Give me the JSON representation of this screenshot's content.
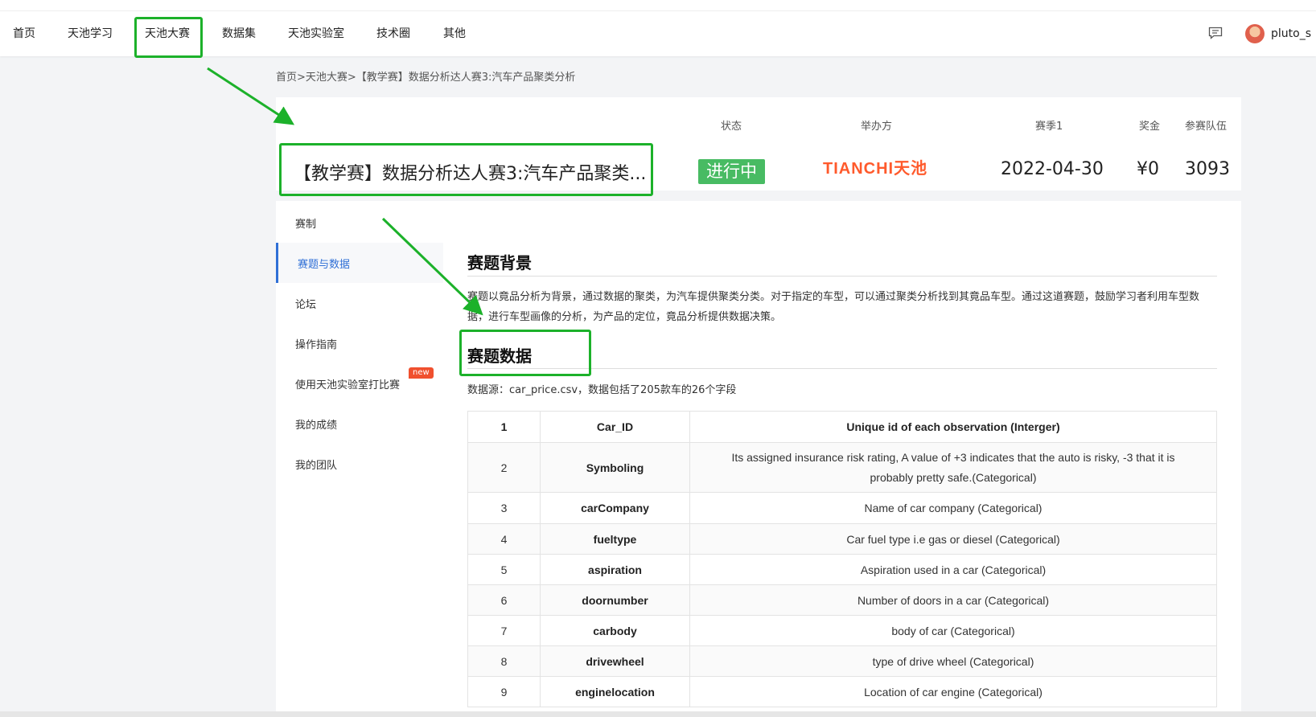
{
  "nav": {
    "items": [
      "首页",
      "天池学习",
      "天池大赛",
      "数据集",
      "天池实验室",
      "技术圈",
      "其他"
    ],
    "active_index": 2
  },
  "user": {
    "name": "pluto_s",
    "message_icon": "message-icon"
  },
  "breadcrumb": "首页>天池大赛>【教学赛】数据分析达人赛3:汽车产品聚类分析",
  "competition": {
    "title": "【教学赛】数据分析达人赛3:汽车产品聚类...",
    "columns": {
      "status": "状态",
      "organizer": "举办方",
      "season": "赛季1",
      "prize": "奖金",
      "teams": "参赛队伍"
    },
    "status_value": "进行中",
    "organizer_logo": "TIANCHI天池",
    "season_value": "2022-04-30",
    "prize_value": "¥0",
    "teams_value": "3093"
  },
  "sidebar": {
    "items": [
      "赛制",
      "赛题与数据",
      "论坛",
      "操作指南",
      "使用天池实验室打比赛",
      "我的成绩",
      "我的团队"
    ],
    "active_index": 1,
    "new_badge": "new"
  },
  "content": {
    "background_title": "赛题背景",
    "background_text": "赛题以竟品分析为背景，通过数据的聚类，为汽车提供聚类分类。对于指定的车型，可以通过聚类分析找到其竟品车型。通过这道赛题，鼓励学习者利用车型数据，进行车型画像的分析，为产品的定位，竟品分析提供数据决策。",
    "data_title": "赛题数据",
    "data_source": "数据源：car_price.csv，数据包括了205款车的26个字段",
    "table": [
      {
        "num": "1",
        "name": "Car_ID",
        "desc": "Unique id of each observation (Interger)"
      },
      {
        "num": "2",
        "name": "Symboling",
        "desc": "Its assigned insurance risk rating, A value of +3 indicates that the auto is risky, -3 that it is probably pretty safe.(Categorical)"
      },
      {
        "num": "3",
        "name": "carCompany",
        "desc": "Name of car company (Categorical)"
      },
      {
        "num": "4",
        "name": "fueltype",
        "desc": "Car fuel type i.e gas or diesel (Categorical)"
      },
      {
        "num": "5",
        "name": "aspiration",
        "desc": "Aspiration used in a car (Categorical)"
      },
      {
        "num": "6",
        "name": "doornumber",
        "desc": "Number of doors in a car (Categorical)"
      },
      {
        "num": "7",
        "name": "carbody",
        "desc": "body of car (Categorical)"
      },
      {
        "num": "8",
        "name": "drivewheel",
        "desc": "type of drive wheel (Categorical)"
      },
      {
        "num": "9",
        "name": "enginelocation",
        "desc": "Location of car engine (Categorical)"
      }
    ]
  },
  "colors": {
    "highlight": "#1cb12a",
    "status_green": "#48bb63",
    "brand_orange": "#ff5a2c",
    "active_blue": "#2f6fd6"
  }
}
